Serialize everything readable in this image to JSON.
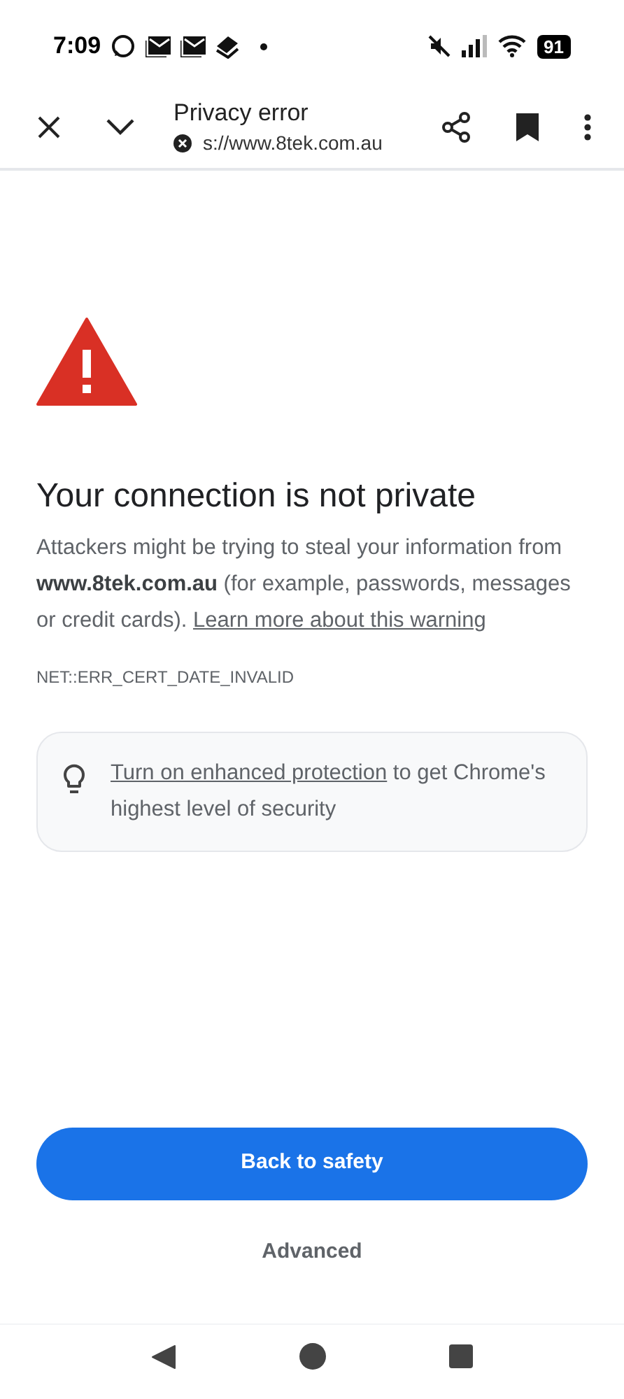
{
  "status_bar": {
    "time": "7:09",
    "battery": "91"
  },
  "toolbar": {
    "title": "Privacy error",
    "url": "s://www.8tek.com.au"
  },
  "heading": "Your connection is not private",
  "paragraph": {
    "text": "Attackers might be trying to steal your information from **www.8tek.com.au** (for example, passwords, messages or credit cards).",
    "link": "Learn more about this warning"
  },
  "error_code": "NET::ERR_CERT_DATE_INVALID",
  "tip": {
    "link": "Turn on enhanced protection",
    "text": "to get Chrome's highest level of security"
  },
  "primary_button": "Back to safety",
  "secondary_button": "Advanced"
}
